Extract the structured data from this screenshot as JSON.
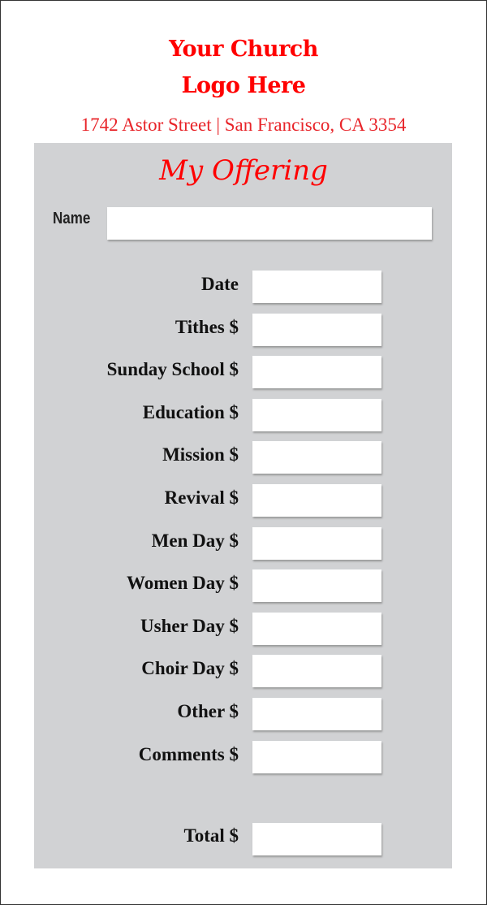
{
  "header": {
    "logo_line1": "Your Church",
    "logo_line2": "Logo Here",
    "address": "1742 Astor Street | San Francisco, CA 3354"
  },
  "form": {
    "title": "My Offering",
    "name_label": "Name",
    "name_value": "",
    "fields": [
      {
        "label": "Date",
        "value": ""
      },
      {
        "label": "Tithes $",
        "value": ""
      },
      {
        "label": "Sunday School $",
        "value": ""
      },
      {
        "label": "Education $",
        "value": ""
      },
      {
        "label": "Mission $",
        "value": ""
      },
      {
        "label": "Revival $",
        "value": ""
      },
      {
        "label": "Men Day $",
        "value": ""
      },
      {
        "label": "Women Day $",
        "value": ""
      },
      {
        "label": "Usher Day $",
        "value": ""
      },
      {
        "label": "Choir Day $",
        "value": ""
      },
      {
        "label": "Other $",
        "value": ""
      },
      {
        "label": "Comments $",
        "value": ""
      }
    ],
    "total_label": "Total $",
    "total_value": ""
  },
  "colors": {
    "accent": "#ff0000",
    "panel": "#d1d2d4"
  }
}
